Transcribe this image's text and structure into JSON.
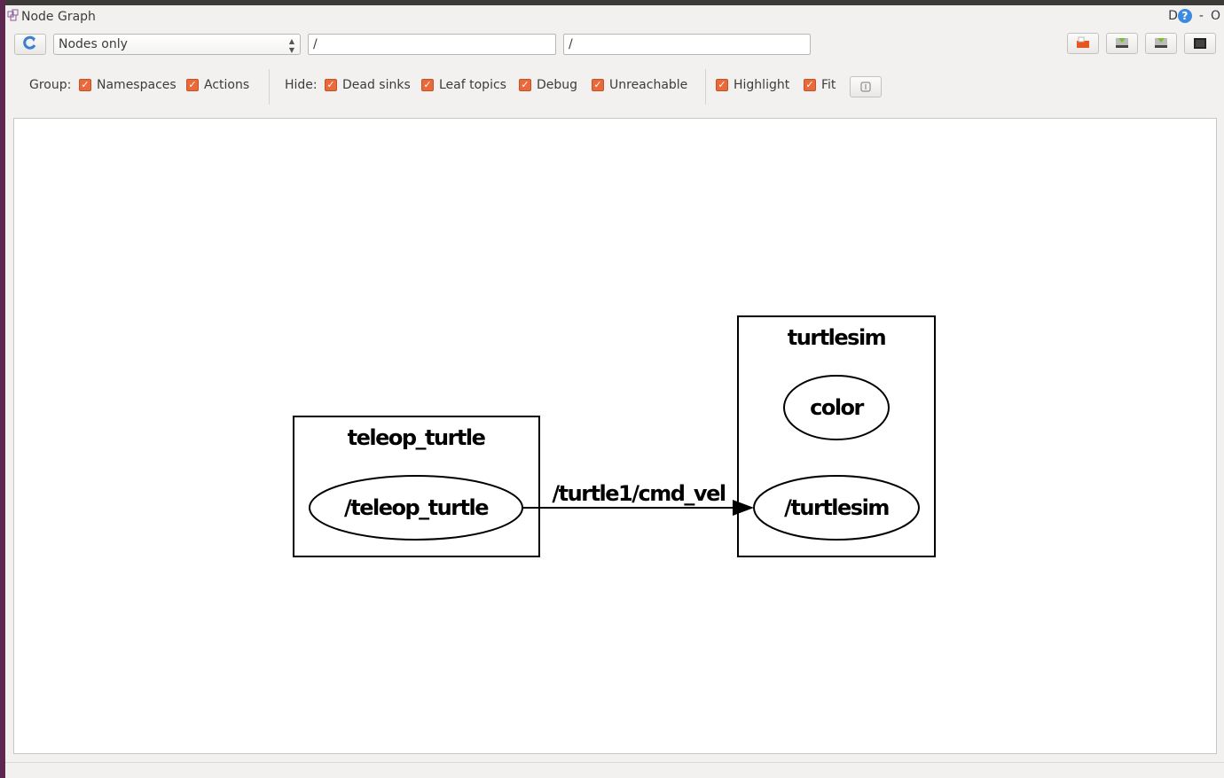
{
  "window": {
    "title": "Node Graph",
    "icon": "rqt-graph-icon",
    "controls": [
      "D",
      "?",
      "-",
      "O"
    ]
  },
  "toolbar": {
    "refresh_icon": "refresh-icon",
    "mode_select": "Nodes only",
    "ns_filter": "/",
    "topic_filter": "/",
    "right_buttons": [
      "load-dot-icon",
      "save-dot-icon",
      "save-svg-icon",
      "screenshot-icon"
    ]
  },
  "options": {
    "group_label": "Group:",
    "hide_label": "Hide:",
    "namespaces": "Namespaces",
    "actions": "Actions",
    "dead_sinks": "Dead sinks",
    "leaf_topics": "Leaf topics",
    "debug": "Debug",
    "unreachable": "Unreachable",
    "highlight": "Highlight",
    "fit": "Fit",
    "checkbox_color": "#e9693a"
  },
  "graph": {
    "clusters": [
      {
        "label": "teleop_turtle"
      },
      {
        "label": "turtlesim"
      }
    ],
    "nodes": [
      {
        "label": "/teleop_turtle"
      },
      {
        "label": "color"
      },
      {
        "label": "/turtlesim"
      }
    ],
    "edges": [
      {
        "from": "/teleop_turtle",
        "to": "/turtlesim",
        "label": "/turtle1/cmd_vel"
      }
    ]
  }
}
